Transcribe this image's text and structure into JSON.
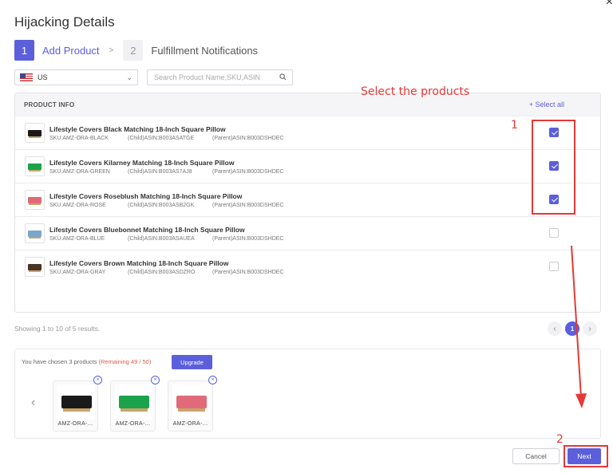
{
  "modal": {
    "title": "Hijacking Details",
    "close_glyph": "×"
  },
  "steps": [
    {
      "num": "1",
      "label": "Add Product"
    },
    {
      "num": "2",
      "label": "Fulfillment Notifications"
    }
  ],
  "step_separator": ">",
  "filters": {
    "country": "US",
    "search_placeholder": "Search Product Name,SKU,ASIN"
  },
  "table": {
    "header": "PRODUCT INFO",
    "select_all": "+ Select all",
    "rows": [
      {
        "name": "Lifestyle Covers Black Matching 18-Inch Square Pillow",
        "sku": "SKU:AMZ-ORA-BLACK",
        "child": "(Child)ASIN:B003ASATGE",
        "parent": "(Parent)ASIN:B003DSHDEC",
        "checked": true,
        "color": "#1a1a1a"
      },
      {
        "name": "Lifestyle Covers Kilarney Matching 18-Inch Square Pillow",
        "sku": "SKU:AMZ-ORA-GREEN",
        "child": "(Child)ASIN:B003AS7AJ8",
        "parent": "(Parent)ASIN:B003DSHDEC",
        "checked": true,
        "color": "#1aa34a"
      },
      {
        "name": "Lifestyle Covers Roseblush Matching 18-Inch Square Pillow",
        "sku": "SKU:AMZ-ORA-ROSE",
        "child": "(Child)ASIN:B003ASB2GK",
        "parent": "(Parent)ASIN:B003DSHDEC",
        "checked": true,
        "color": "#e06a7a"
      },
      {
        "name": "Lifestyle Covers Bluebonnet Matching 18-Inch Square Pillow",
        "sku": "SKU:AMZ-ORA-BLUE",
        "child": "(Child)ASIN:B003ASAUEA",
        "parent": "(Parent)ASIN:B003DSHDEC",
        "checked": false,
        "color": "#7aa6cc"
      },
      {
        "name": "Lifestyle Covers Brown Matching 18-Inch Square Pillow",
        "sku": "SKU:AMZ-ORA-GRAY",
        "child": "(Child)ASIN:B003ASDZRO",
        "parent": "(Parent)ASIN:B003DSHDEC",
        "checked": false,
        "color": "#4a3324"
      }
    ]
  },
  "pagination": {
    "showing": "Showing 1 to 10 of 5 results.",
    "current_page": "1",
    "prev": "‹",
    "next": "›"
  },
  "chosen": {
    "text_prefix": "You have chosen 3 products",
    "remaining": "(Remaining 49 / 50)",
    "upgrade_label": "Upgrade",
    "left_arrow": "‹",
    "remove_glyph": "×",
    "items": [
      {
        "label": "AMZ-ORA-...",
        "color": "#1a1a1a"
      },
      {
        "label": "AMZ-ORA-...",
        "color": "#1aa34a"
      },
      {
        "label": "AMZ-ORA-...",
        "color": "#e06a7a"
      }
    ]
  },
  "footer": {
    "cancel_label": "Cancel",
    "next_label": "Next"
  },
  "annotations": {
    "instruction": "Select the products",
    "marker1": "1",
    "marker2": "2"
  },
  "colors": {
    "accent": "#5b5fdb",
    "annotation_red": "#e53935",
    "remaining_red": "#e05b4b"
  }
}
